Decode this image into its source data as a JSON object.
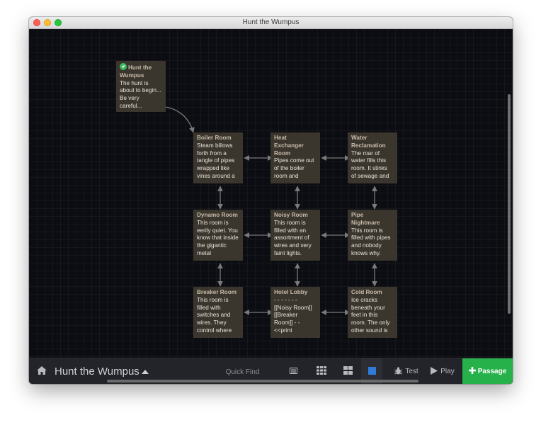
{
  "window": {
    "title": "Hunt the Wumpus"
  },
  "passages": [
    {
      "title": "Hunt the Wumpus",
      "excerpt": "The hunt is about to begin... Be very careful...",
      "start": true
    },
    {
      "title": "Boiler Room",
      "excerpt": "Steam billows forth from a tangle of pipes wrapped like vines around a"
    },
    {
      "title": "Heat Exchanger Room",
      "excerpt": "Pipes come out of the boiler room and"
    },
    {
      "title": "Water Reclamation",
      "excerpt": "The roar of water fills this room. It stinks of sewage and"
    },
    {
      "title": "Dynamo Room",
      "excerpt": "This room is eerily quiet. You know that inside the gigantic metal"
    },
    {
      "title": "Noisy Room",
      "excerpt": "This room is filled with an assortment of wires and very faint lights."
    },
    {
      "title": "Pipe Nightmare",
      "excerpt": "This room is filled with pipes and nobody knows why."
    },
    {
      "title": "Breaker Room",
      "excerpt": "This room is filled with switches and wires. They control where"
    },
    {
      "title": "Hotel Lobby",
      "excerpt": "- - - - - - - [[Noisy Room]] [[Breaker Room]] - - <<print"
    },
    {
      "title": "Cold Room",
      "excerpt": "Ice cracks beneath your feet in this room. The only other sound is"
    }
  ],
  "toolbar": {
    "story_title": "Hunt the Wumpus",
    "quick_find_placeholder": "Quick Find",
    "test_label": "Test",
    "play_label": "Play",
    "passage_label": "Passage"
  },
  "colors": {
    "canvas": "#0c0d12",
    "passage_card": "#3a352d",
    "toolbar": "#23242a",
    "passage_button": "#27b14a",
    "start_badge": "#3cb861"
  }
}
